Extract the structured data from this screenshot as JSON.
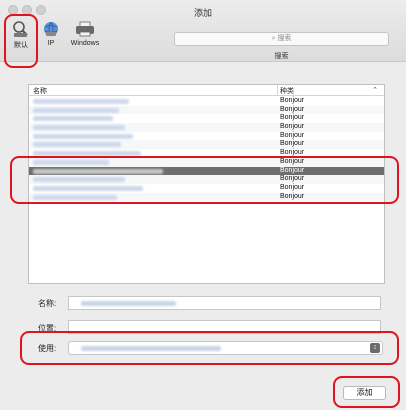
{
  "window": {
    "title": "添加"
  },
  "toolbar": {
    "items": [
      {
        "label": "默认",
        "icon": "default-printer-icon"
      },
      {
        "label": "IP",
        "icon": "ip-globe-icon"
      },
      {
        "label": "Windows",
        "icon": "windows-printer-icon"
      }
    ],
    "search_placeholder": "搜索",
    "search_caption": "搜索"
  },
  "table": {
    "headers": {
      "name": "名称",
      "kind": "种类"
    },
    "rows": [
      {
        "kind": "Bonjour",
        "selected": false
      },
      {
        "kind": "Bonjour",
        "selected": false
      },
      {
        "kind": "Bonjour",
        "selected": false
      },
      {
        "kind": "Bonjour",
        "selected": false
      },
      {
        "kind": "Bonjour",
        "selected": false
      },
      {
        "kind": "Bonjour",
        "selected": false
      },
      {
        "kind": "Bonjour",
        "selected": false
      },
      {
        "kind": "Bonjour",
        "selected": false
      },
      {
        "kind": "Bonjour",
        "selected": true
      },
      {
        "kind": "Bonjour",
        "selected": false
      },
      {
        "kind": "Bonjour",
        "selected": false
      },
      {
        "kind": "Bonjour",
        "selected": false
      }
    ]
  },
  "form": {
    "name_label": "名称:",
    "location_label": "位置:",
    "use_label": "使用:"
  },
  "actions": {
    "add_label": "添加"
  },
  "colors": {
    "annotation": "#e0141e",
    "selection": "#6e6e6e"
  }
}
